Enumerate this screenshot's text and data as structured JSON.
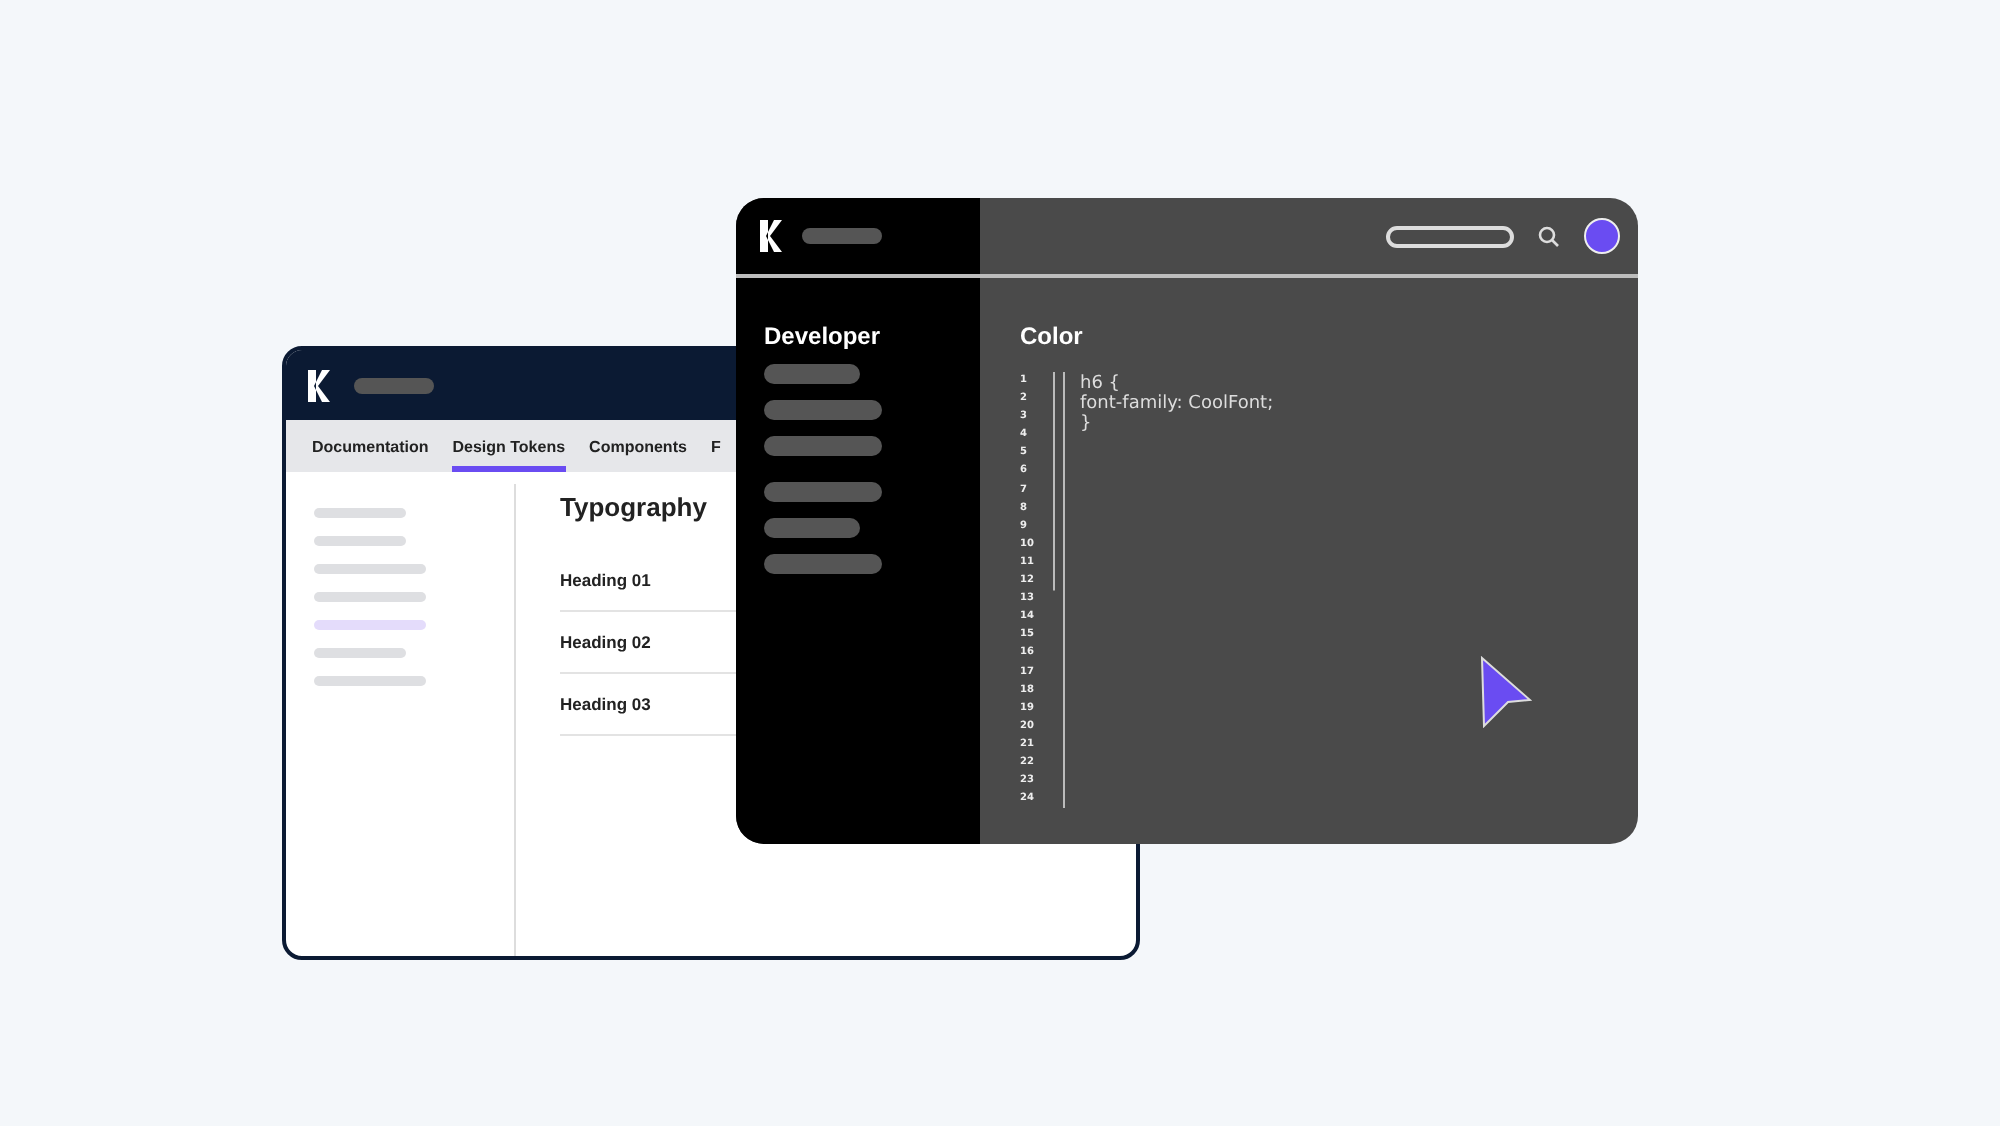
{
  "back_window": {
    "tabs": [
      {
        "label": "Documentation",
        "selected": false
      },
      {
        "label": "Design Tokens",
        "selected": true
      },
      {
        "label": "Components",
        "selected": false
      },
      {
        "label": "F",
        "selected": false
      }
    ],
    "sidebar": {
      "items": [
        {
          "selected": false
        },
        {
          "selected": false
        },
        {
          "selected": false
        },
        {
          "selected": false
        },
        {
          "selected": true
        },
        {
          "selected": false
        },
        {
          "selected": false
        }
      ]
    },
    "title": "Typography",
    "headings": [
      "Heading 01",
      "Heading 02",
      "Heading 03"
    ]
  },
  "front_window": {
    "sidebar": {
      "title": "Developer",
      "items": [
        {
          "selected": false
        },
        {
          "selected": false
        },
        {
          "selected": false
        },
        {
          "selected": false
        },
        {
          "selected": false
        },
        {
          "selected": false
        }
      ]
    },
    "title": "Color",
    "line_numbers": [
      "1",
      "2",
      "3",
      "4",
      "5",
      "6",
      "7",
      "8",
      "9",
      "10",
      "11",
      "12",
      "13",
      "14",
      "15",
      "16",
      "17",
      "18",
      "19",
      "20",
      "21",
      "22",
      "23",
      "24"
    ],
    "code": [
      "h6 {",
      "font-family: CoolFont;",
      "}"
    ]
  }
}
